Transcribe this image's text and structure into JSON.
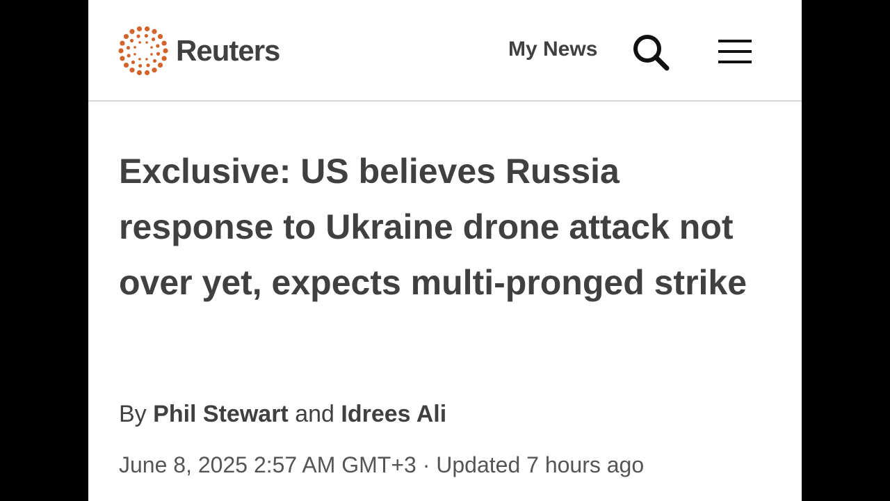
{
  "header": {
    "brand_name": "Reuters",
    "logo_icon": "reuters-dot-ring-icon",
    "my_news_label": "My News",
    "search_icon": "search-icon",
    "menu_icon": "hamburger-menu-icon",
    "brand_color": "#d4622b"
  },
  "article": {
    "headline": "Exclusive: US believes Russia response to Ukraine drone attack not over yet, expects multi-pronged strike",
    "byline": {
      "prefix": "By",
      "author1": "Phil Stewart",
      "conjunction": "and",
      "author2": "Idrees Ali"
    },
    "published": "June 8, 2025 2:57 AM GMT+3",
    "separator": "·",
    "updated": "Updated 7 hours ago"
  }
}
